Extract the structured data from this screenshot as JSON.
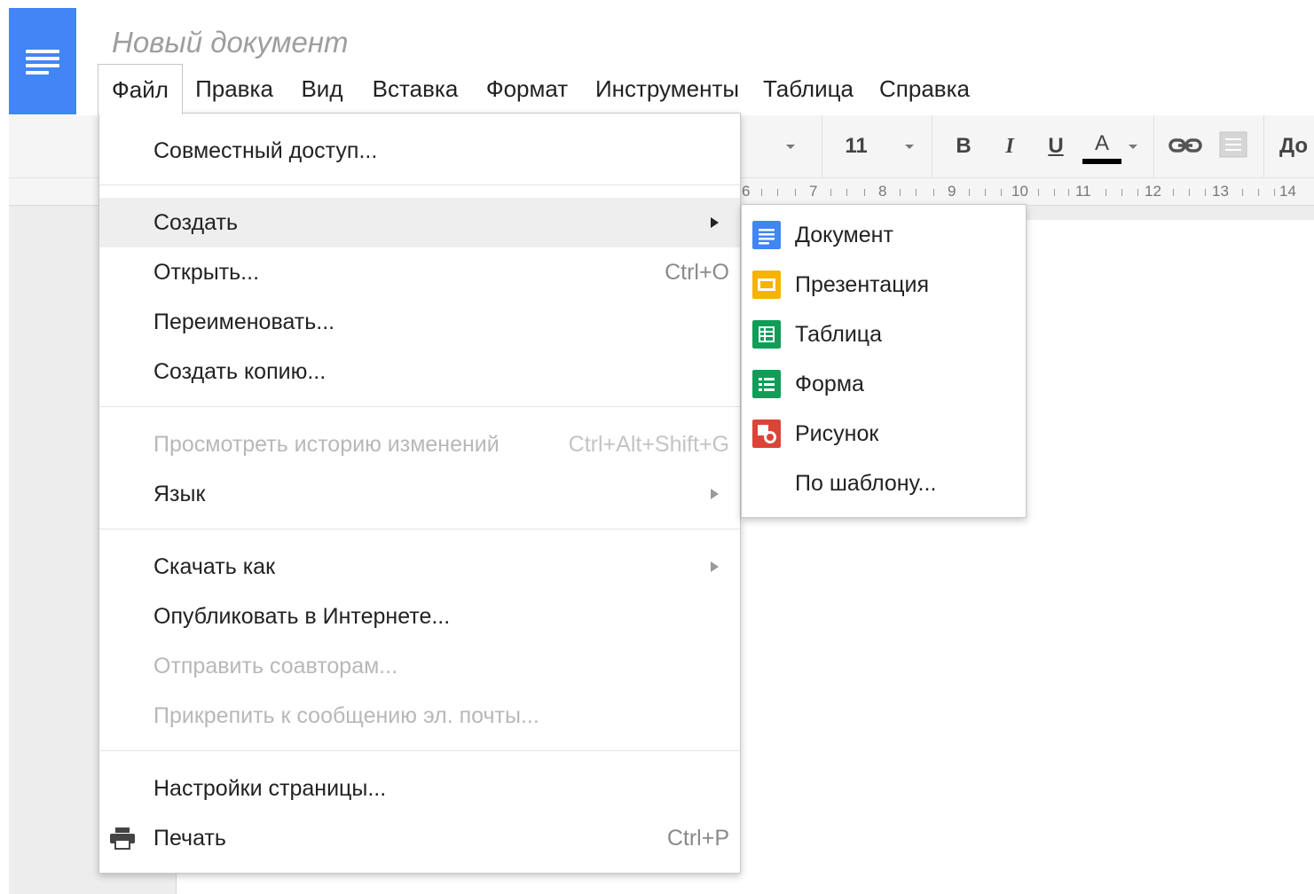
{
  "app": {
    "logo_icon": "docs-logo-icon",
    "brand_color": "#4285f4"
  },
  "document": {
    "title": "Новый документ"
  },
  "menubar": {
    "items": [
      "Файл",
      "Правка",
      "Вид",
      "Вставка",
      "Формат",
      "Инструменты",
      "Таблица",
      "Справка"
    ],
    "active": "Файл"
  },
  "toolbar": {
    "font_size": "11",
    "bold": "B",
    "italic": "I",
    "underline": "U",
    "text_color": "A",
    "style_partial": "До"
  },
  "ruler": {
    "marks": [
      "6",
      "7",
      "8",
      "9",
      "10",
      "11",
      "12",
      "13",
      "14"
    ]
  },
  "file_menu": {
    "share": "Совместный доступ...",
    "create": "Создать",
    "open": "Открыть...",
    "open_shortcut": "Ctrl+O",
    "rename": "Переименовать...",
    "copy": "Создать копию...",
    "history": "Просмотреть историю изменений",
    "history_shortcut": "Ctrl+Alt+Shift+G",
    "language": "Язык",
    "download": "Скачать как",
    "publish": "Опубликовать в Интернете...",
    "email_collaborators": "Отправить соавторам...",
    "email_attachment": "Прикрепить к сообщению эл. почты...",
    "page_setup": "Настройки страницы...",
    "print": "Печать",
    "print_shortcut": "Ctrl+P"
  },
  "create_submenu": {
    "document": "Документ",
    "presentation": "Презентация",
    "spreadsheet": "Таблица",
    "form": "Форма",
    "drawing": "Рисунок",
    "from_template": "По шаблону...",
    "colors": {
      "document": "#4285f4",
      "presentation": "#f4b400",
      "spreadsheet": "#0f9d58",
      "form": "#0f9d58",
      "drawing": "#db4437"
    }
  }
}
